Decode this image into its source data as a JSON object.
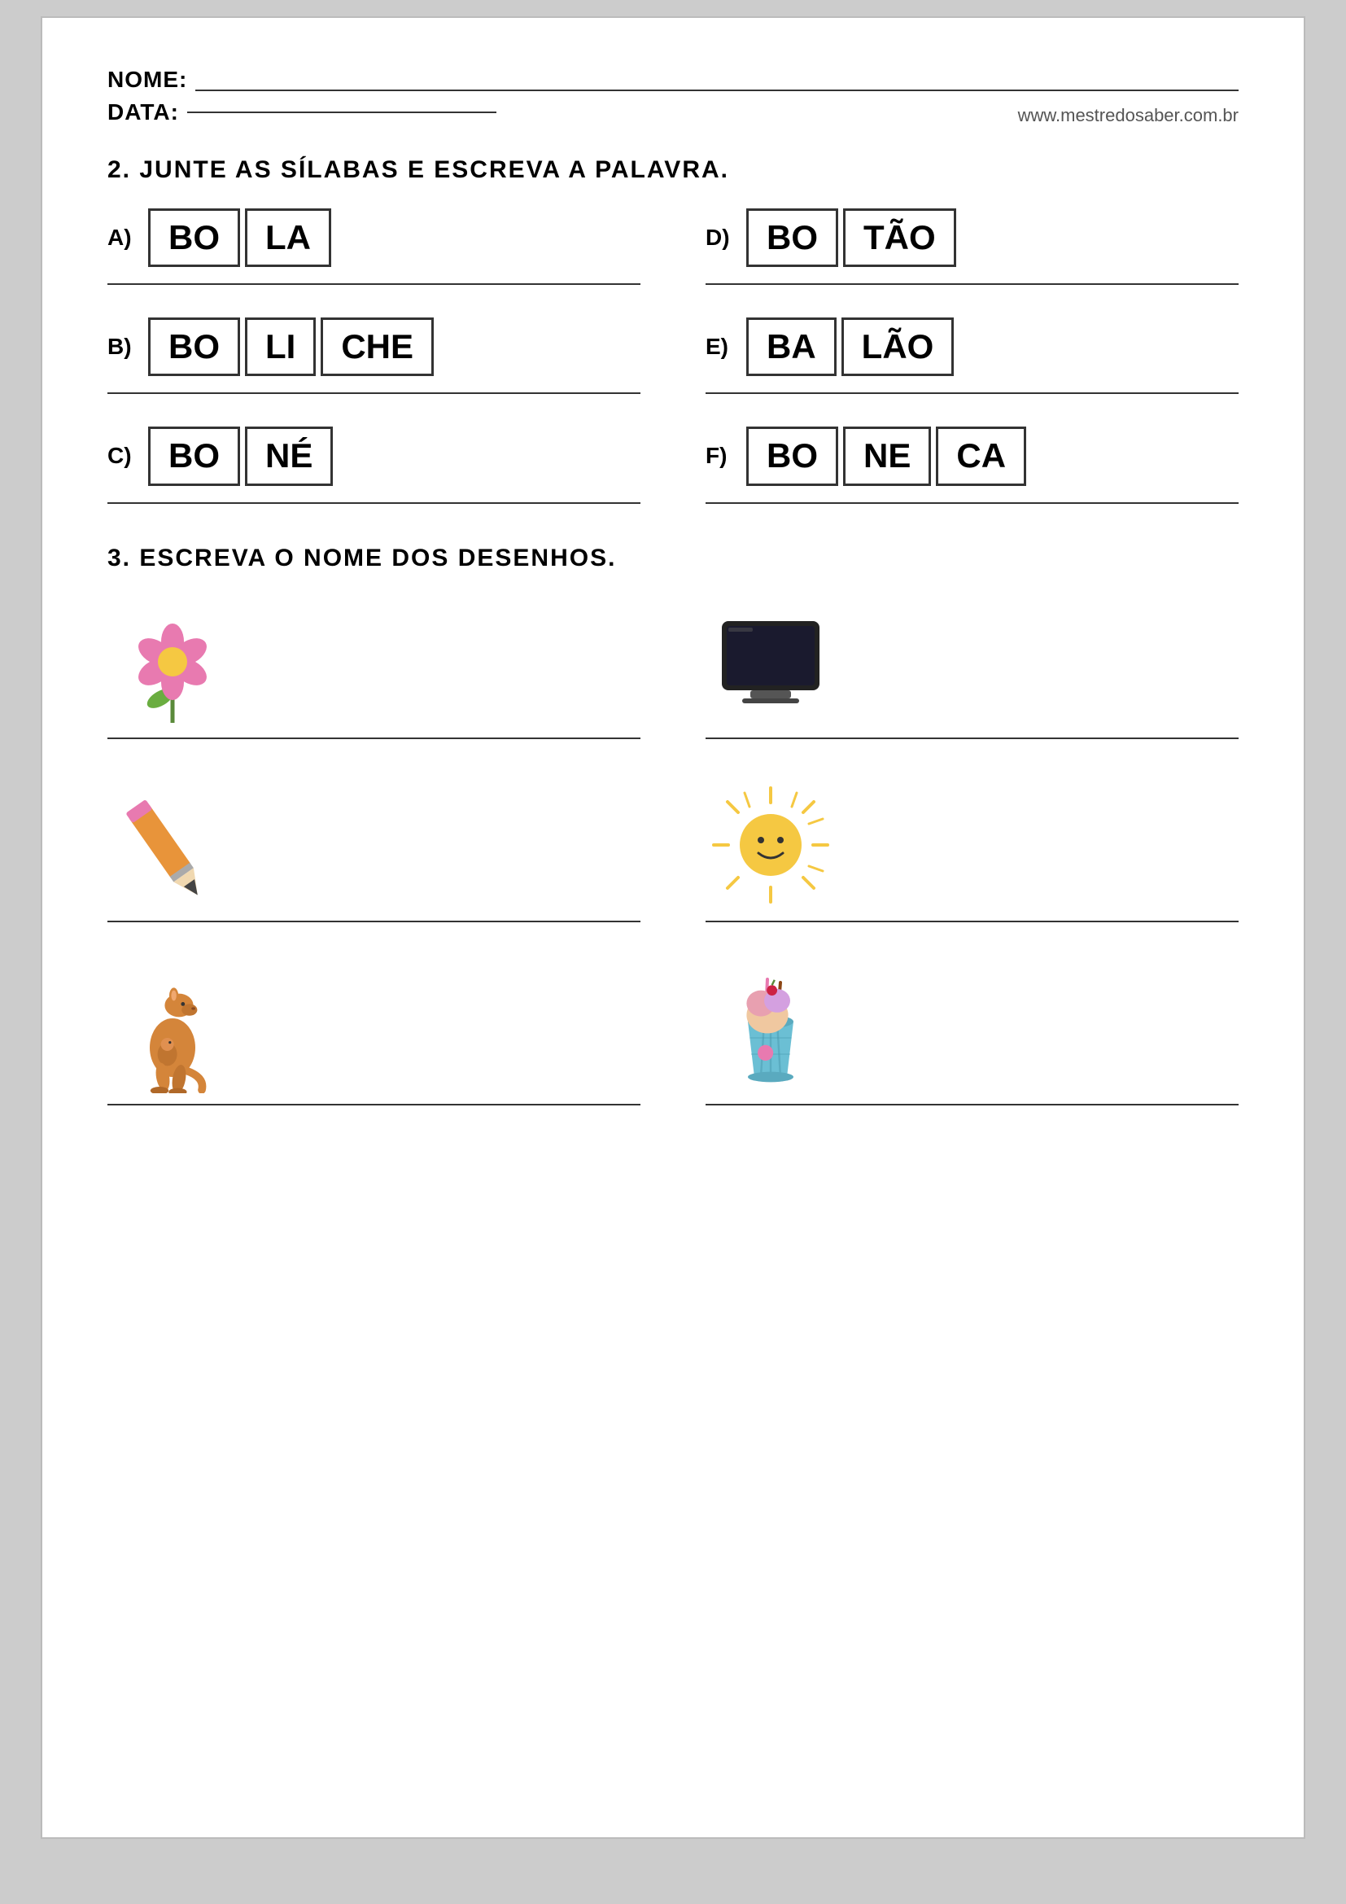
{
  "header": {
    "nome_label": "NOME:",
    "data_label": "DATA:",
    "website": "www.mestredosaber.com.br"
  },
  "section2": {
    "title": "2. JUNTE AS SÍLABAS E ESCREVA A PALAVRA.",
    "exercises": [
      {
        "id": "A",
        "syllables": [
          "BO",
          "LA"
        ]
      },
      {
        "id": "D",
        "syllables": [
          "BO",
          "TÃO"
        ]
      },
      {
        "id": "B",
        "syllables": [
          "BO",
          "LI",
          "CHE"
        ]
      },
      {
        "id": "E",
        "syllables": [
          "BA",
          "LÃO"
        ]
      },
      {
        "id": "C",
        "syllables": [
          "BO",
          "NÉ"
        ]
      },
      {
        "id": "F",
        "syllables": [
          "BO",
          "NE",
          "CA"
        ]
      }
    ]
  },
  "section3": {
    "title": "3. ESCREVA O NOME DOS DESENHOS.",
    "drawings": [
      {
        "id": "flower",
        "label": "flor"
      },
      {
        "id": "tv",
        "label": "televisão"
      },
      {
        "id": "pencil",
        "label": "lápis"
      },
      {
        "id": "sun",
        "label": "sol"
      },
      {
        "id": "kangaroo",
        "label": "canguru"
      },
      {
        "id": "icecream",
        "label": "sorvete"
      }
    ]
  }
}
